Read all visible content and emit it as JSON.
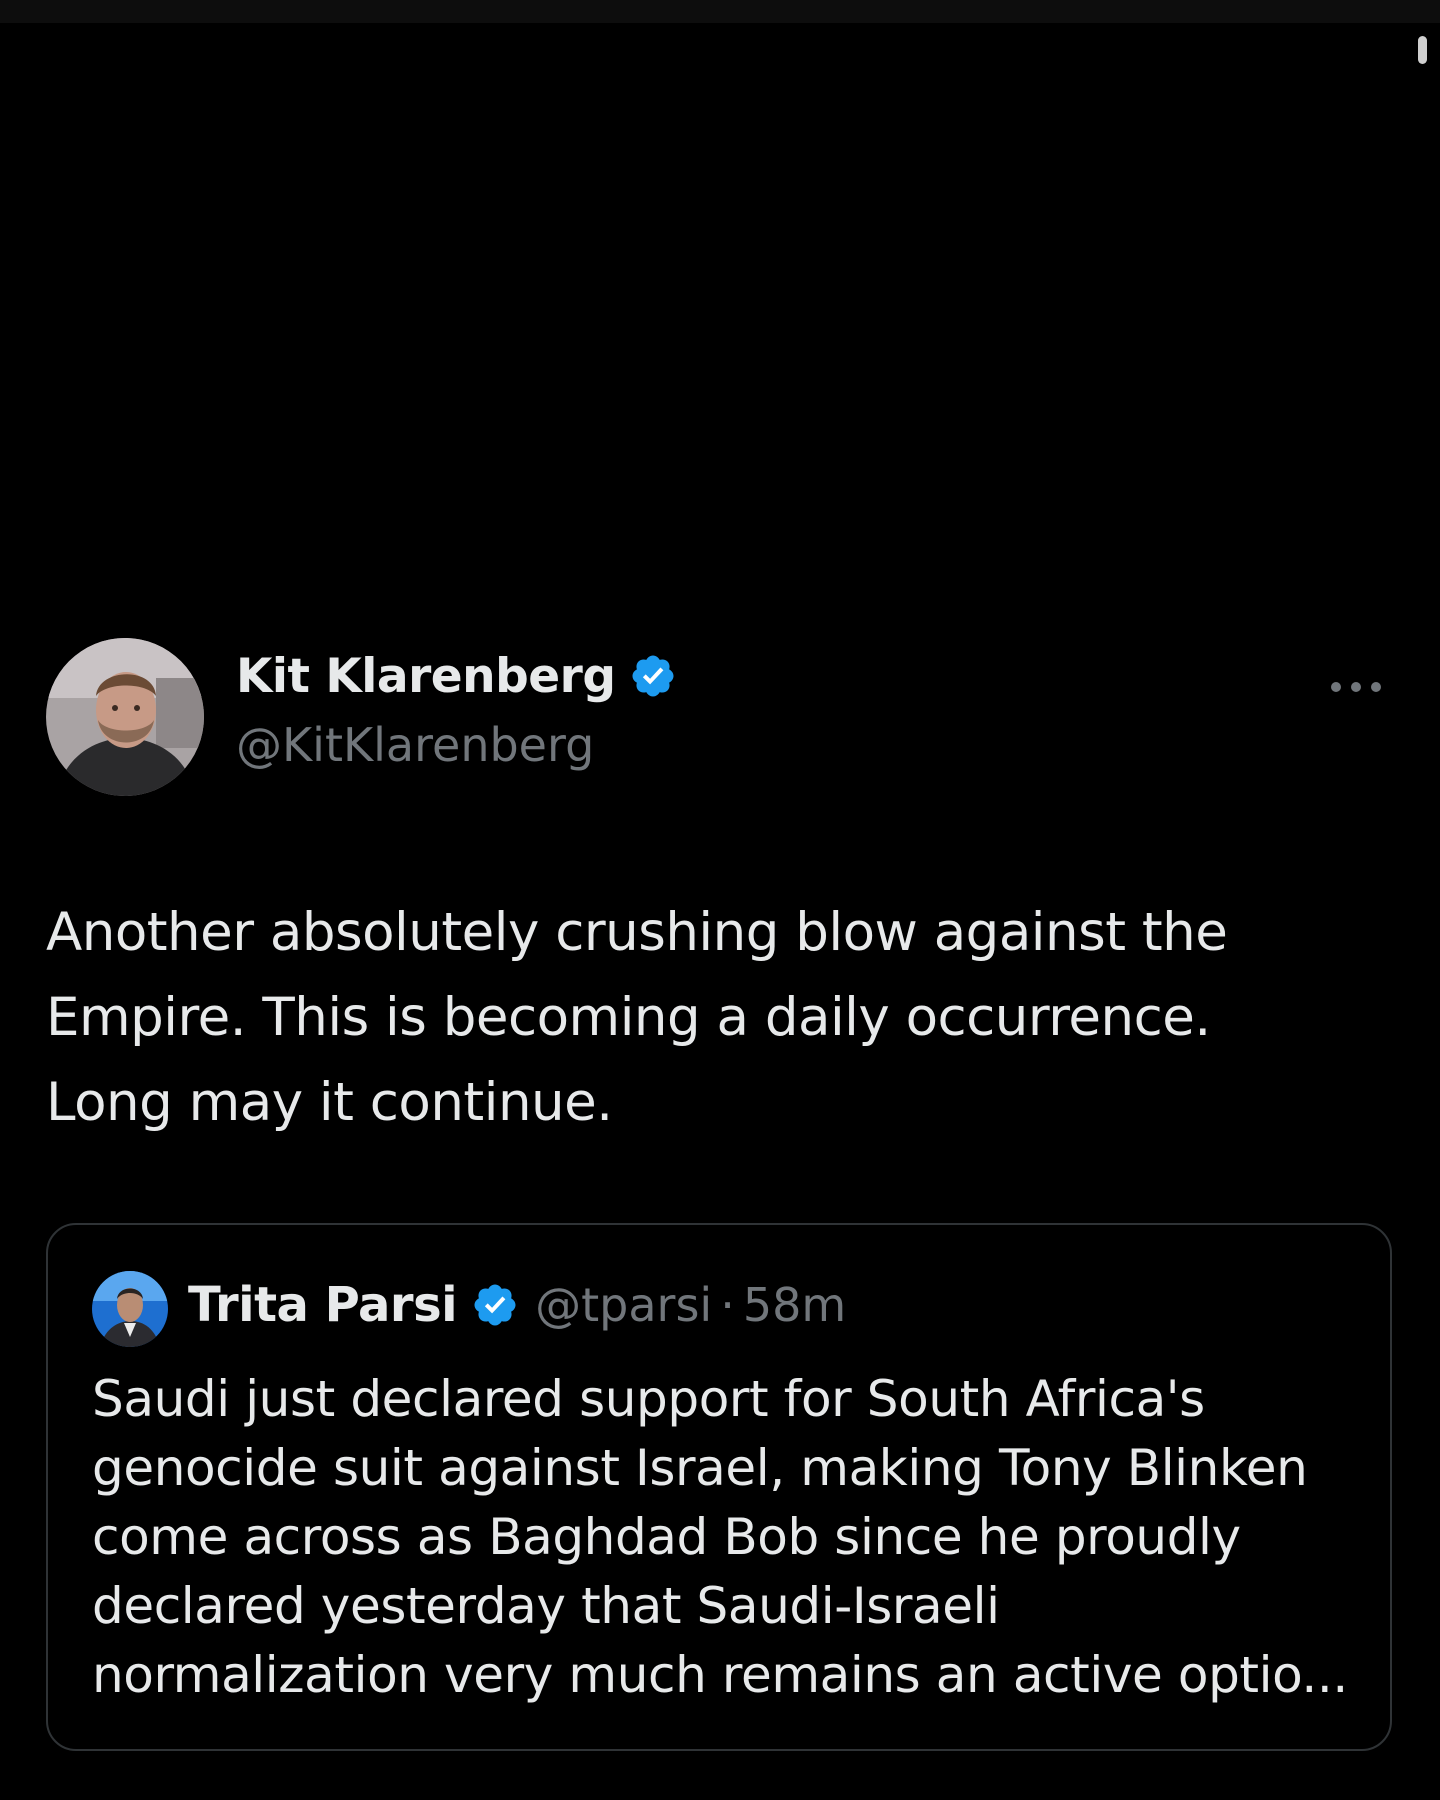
{
  "colors": {
    "background": "#000000",
    "text_primary": "#e7e9ea",
    "text_secondary": "#71767b",
    "verified_blue": "#1d9bf0",
    "card_border": "#2f3336"
  },
  "tweet": {
    "author": {
      "name": "Kit Klarenberg",
      "handle": "@KitKlarenberg",
      "verified_icon": "verified-badge-icon",
      "avatar_icon": "user-avatar"
    },
    "more_icon": "more-options-icon",
    "text_lines": [
      "Another absolutely crushing blow against the",
      "Empire. This is becoming a daily occurrence.",
      "Long may it continue."
    ],
    "quoted": {
      "author": {
        "name": "Trita Parsi",
        "handle": "@tparsi",
        "separator": "·",
        "time": "58m",
        "verified_icon": "verified-badge-icon",
        "avatar_icon": "user-avatar"
      },
      "text_lines": [
        "Saudi just declared support for South Africa's",
        "genocide suit against Israel, making Tony Blinken",
        "come across as Baghdad Bob since he proudly",
        "declared yesterday that Saudi-Israeli",
        "normalization very much remains an active optio..."
      ]
    }
  }
}
